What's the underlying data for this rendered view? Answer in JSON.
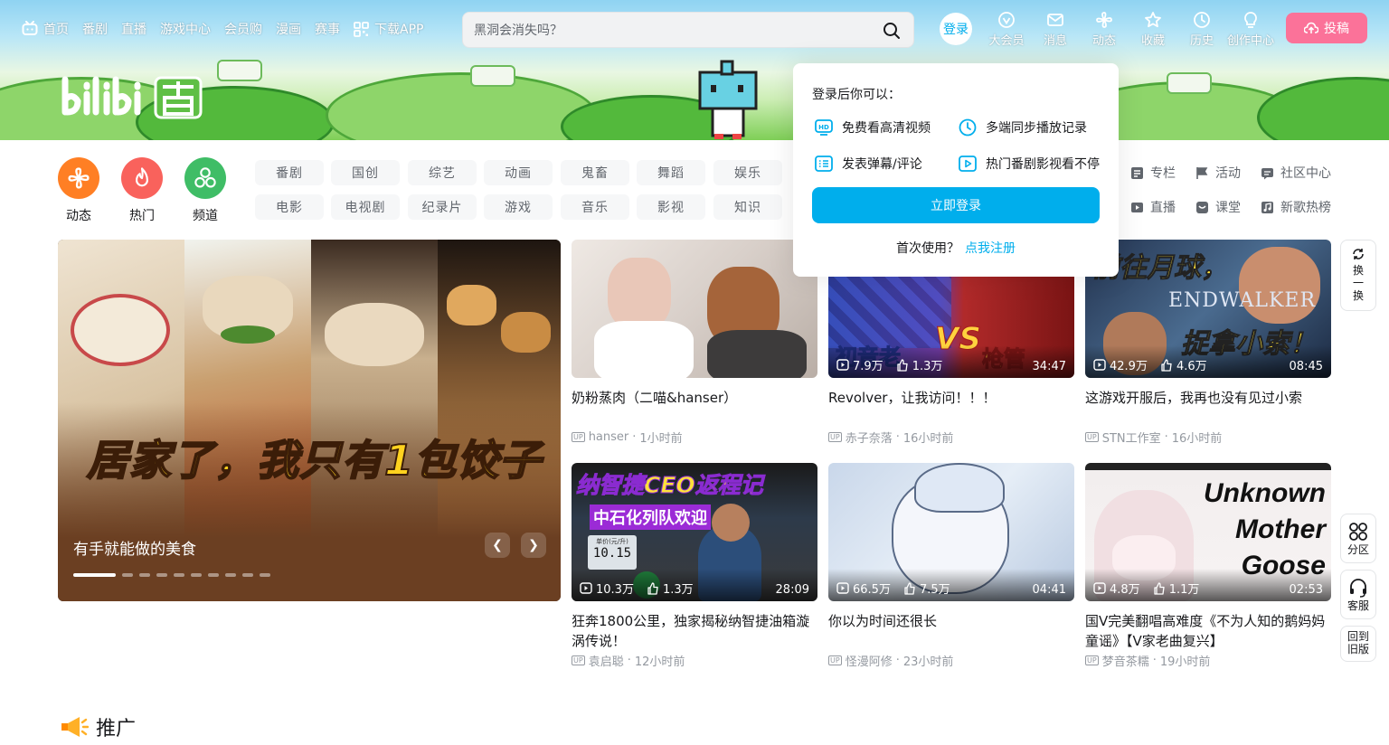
{
  "topnav": {
    "items": [
      {
        "label": "首页",
        "icon": "tv-icon"
      },
      {
        "label": "番剧"
      },
      {
        "label": "直播"
      },
      {
        "label": "游戏中心"
      },
      {
        "label": "会员购"
      },
      {
        "label": "漫画"
      },
      {
        "label": "赛事"
      },
      {
        "label": "下载APP",
        "icon": "qrcode-icon"
      }
    ]
  },
  "search": {
    "placeholder": "黑洞会消失吗？"
  },
  "user": {
    "login_label": "登录"
  },
  "navright": {
    "items": [
      {
        "label": "大会员"
      },
      {
        "label": "消息"
      },
      {
        "label": "动态"
      },
      {
        "label": "收藏"
      },
      {
        "label": "历史"
      },
      {
        "label": "创作中心"
      }
    ],
    "upload_label": "投稿"
  },
  "popup": {
    "title": "登录后你可以：",
    "features": [
      "免费看高清视频",
      "多端同步播放记录",
      "发表弹幕/评论",
      "热门番剧影视看不停"
    ],
    "login_button": "立即登录",
    "first_use": "首次使用？",
    "register_link": "点我注册"
  },
  "channels": {
    "icons": [
      {
        "label": "动态",
        "color": "#ff7f24"
      },
      {
        "label": "热门",
        "color": "#f9625c"
      },
      {
        "label": "频道",
        "color": "#3fbd66"
      }
    ],
    "row1": [
      "番剧",
      "国创",
      "综艺",
      "动画",
      "鬼畜",
      "舞蹈",
      "娱乐"
    ],
    "row2": [
      "电影",
      "电视剧",
      "纪录片",
      "游戏",
      "音乐",
      "影视",
      "知识"
    ],
    "extras": [
      "专栏",
      "活动",
      "社区中心",
      "直播",
      "课堂",
      "新歌热榜"
    ]
  },
  "carousel": {
    "headline": "居家了，我只有1包饺子",
    "caption": "有手就能做的美食",
    "total_slides": 10,
    "active_slide": 1
  },
  "videos": [
    {
      "title": "奶粉蒸肉（二喵&hanser）",
      "author": "hanser",
      "time": "1小时前",
      "views": "",
      "likes": "",
      "duration": ""
    },
    {
      "title": "Revolver，让我访问！！！",
      "author": "赤子奈落",
      "time": "16小时前",
      "views": "7.9万",
      "likes": "1.3万",
      "duration": "34:47"
    },
    {
      "title": "这游戏开服后，我再也没有见过小索",
      "author": "STN工作室",
      "time": "16小时前",
      "views": "42.9万",
      "likes": "4.6万",
      "duration": "08:45"
    },
    {
      "title": "狂奔1800公里，独家揭秘纳智捷油箱漩涡传说！",
      "author": "袁启聪",
      "time": "12小时前",
      "views": "10.3万",
      "likes": "1.3万",
      "duration": "28:09"
    },
    {
      "title": "你以为时间还很长",
      "author": "怪漫阿修",
      "time": "23小时前",
      "views": "66.5万",
      "likes": "7.5万",
      "duration": "04:41"
    },
    {
      "title": "国V完美翻唱高难度《不为人知的鹅妈妈童谣》【V家老曲复兴】",
      "author": "梦音茶糯",
      "time": "19小时前",
      "views": "4.8万",
      "likes": "1.1万",
      "duration": "02:53"
    }
  ],
  "thumb_text": {
    "v2_vs": "VS",
    "v2_left": "初音老",
    "v2_right": "枪管",
    "v3_banner": "前往月球，",
    "v3_game": "ENDWALKER",
    "v3_sub": "捉拿小索！",
    "v4_banner": "纳智捷CEO返程记",
    "v4_sub": "中石化列队欢迎",
    "v4_gauge": "10.15",
    "v4_gauge_unit": "单价(元/升)",
    "v6_line1": "Unknown",
    "v6_line2": "Mother",
    "v6_line3": "Goose"
  },
  "side": {
    "refresh": "换一换",
    "zone": "分区",
    "service": "客服",
    "old": "回到旧版"
  },
  "promo": {
    "title": "推广"
  },
  "meta": {
    "separator": "·",
    "up_badge": "UP"
  }
}
